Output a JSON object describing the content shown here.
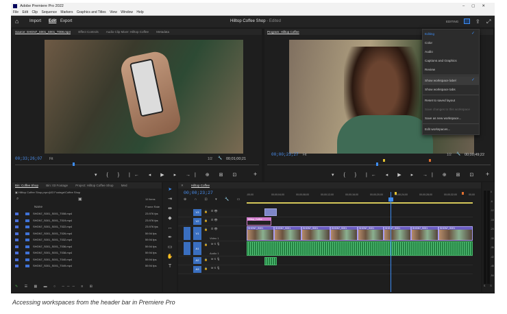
{
  "window": {
    "title": "Adobe Premiere Pro 2022",
    "menu": [
      "File",
      "Edit",
      "Clip",
      "Sequence",
      "Markers",
      "Graphics and Titles",
      "View",
      "Window",
      "Help"
    ],
    "controls": [
      "–",
      "▢",
      "✕"
    ]
  },
  "header": {
    "tabs": [
      "Import",
      "Edit",
      "Export"
    ],
    "active_tab": "Edit",
    "project_title": "Hilltop Coffee Shop",
    "edited": "- Edited",
    "workspace_label": "EDITING"
  },
  "source": {
    "tabs": [
      "Source: SHGN7_S001_S001_T008.mp4",
      "Effect Controls",
      "Audio Clip Mixer: Hilltop Coffee",
      "Metadata"
    ],
    "timecode": "00;33;26;07",
    "fit": "Fit",
    "resolution": "1/2",
    "duration": "00;01;00;21"
  },
  "program": {
    "tab": "Program: Hilltop Coffee",
    "timecode": "00;00;23;27",
    "fit": "Fit",
    "resolution": "1/2",
    "duration": "00;00;49;22"
  },
  "workspace_menu": {
    "items": [
      {
        "label": "Editing",
        "state": "active",
        "check": "✓"
      },
      {
        "label": "Color",
        "state": ""
      },
      {
        "label": "Audio",
        "state": ""
      },
      {
        "label": "Captions and Graphics",
        "state": ""
      },
      {
        "label": "Review",
        "state": ""
      },
      {
        "sep": true
      },
      {
        "label": "Show workspace label",
        "state": "hl",
        "check": "✓"
      },
      {
        "label": "Show workspace tabs",
        "state": ""
      },
      {
        "sep": true
      },
      {
        "label": "Reset to saved layout",
        "state": ""
      },
      {
        "label": "Save changes to this workspace",
        "state": "dis"
      },
      {
        "label": "Save as new workspace...",
        "state": ""
      },
      {
        "sep": true
      },
      {
        "label": "Edit workspaces...",
        "state": ""
      }
    ]
  },
  "project": {
    "tabs": [
      "Bin: Coffee Shop",
      "Bin: 03 Footage",
      "Project: Hilltop Coffee Shop",
      "Med"
    ],
    "path": "Hilltop Coffee Shop.prproj\\03 Footage\\Coffee Shop",
    "items_count": "10 Items",
    "col_name": "Name",
    "col_frame": "Frame Rate",
    "rows": [
      {
        "name": "SHGN7_S001_S001_T008.mp4",
        "fps": "23.976 fps"
      },
      {
        "name": "SHGN7_S001_S001_T019.mp4",
        "fps": "23.976 fps"
      },
      {
        "name": "SHGN7_S001_S001_T022.mp4",
        "fps": "23.976 fps"
      },
      {
        "name": "SHGN7_S001_S001_T026.mp4",
        "fps": "59.94 fps"
      },
      {
        "name": "SHGN7_S001_S001_T032.mp4",
        "fps": "59.94 fps"
      },
      {
        "name": "SHGN7_S001_S001_T036.mp4",
        "fps": "59.94 fps"
      },
      {
        "name": "SHGN7_S001_S001_T038.mp4",
        "fps": "59.94 fps"
      },
      {
        "name": "SHGN7_S001_S001_T040.mp4",
        "fps": "59.94 fps"
      },
      {
        "name": "SHGN7_S001_S001_T049.mp4",
        "fps": "59.94 fps"
      }
    ]
  },
  "timeline": {
    "tab": "Hilltop Coffee",
    "timecode": "00;00;23;27",
    "ruler": [
      ";00;00",
      "00;00;04;00",
      "00;00;08;00",
      "00;00;12;00",
      "00;00;16;00",
      "00;00;20;00",
      "00;00;24;00",
      "00;00;28;00",
      "00;00;32;00",
      "00;00"
    ],
    "tracks": [
      {
        "id": "V3",
        "label": ""
      },
      {
        "id": "V2",
        "label": ""
      },
      {
        "id": "V1",
        "label": "Video 1"
      },
      {
        "id": "A1",
        "label": "Audio 1"
      },
      {
        "id": "A2",
        "label": ""
      },
      {
        "id": "A3",
        "label": ""
      }
    ],
    "graphic_clip": "Hilltop_Coffee",
    "video_clip_label": "SHGN7_S001",
    "meter_scale": [
      "0",
      "-6",
      "-12",
      "-18",
      "-24",
      "-30",
      "-36",
      "-42",
      "-48",
      "-54"
    ],
    "meter_foot": [
      "S",
      "S"
    ]
  },
  "caption": "Accessing workspaces from the header bar in Premiere Pro"
}
